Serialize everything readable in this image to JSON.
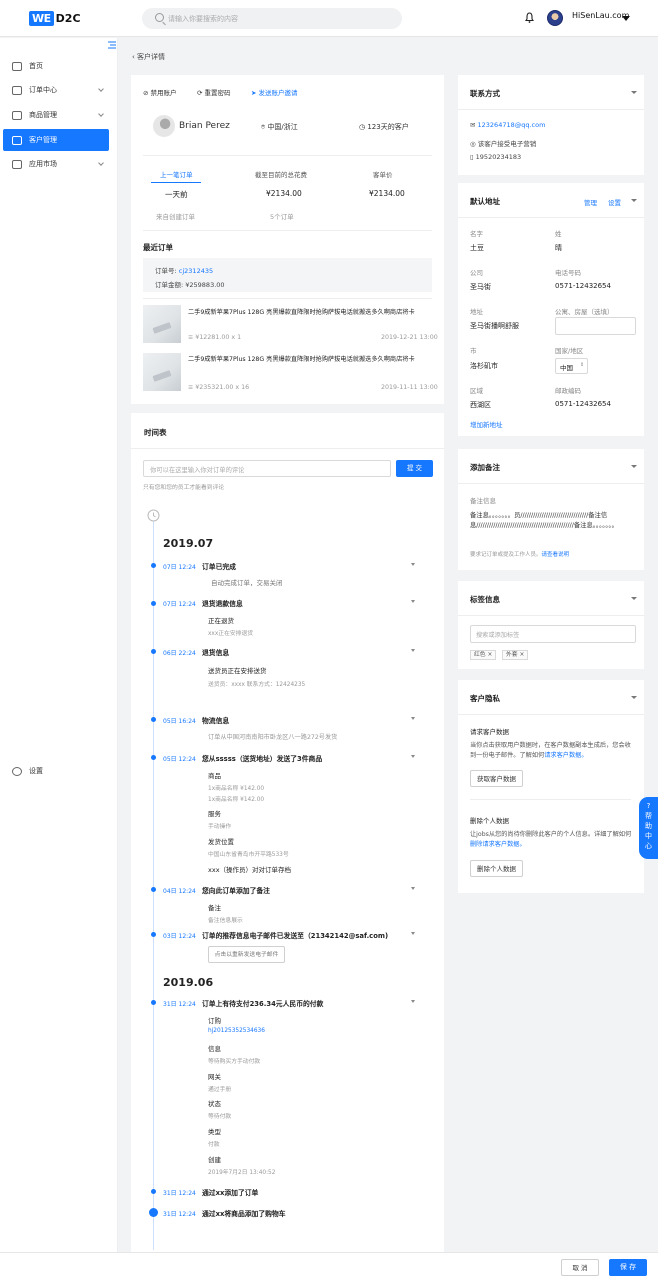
{
  "header": {
    "logo_we": "WE",
    "logo_d2c": "D2C",
    "search_placeholder": "请输入你要搜索的内容",
    "user": "HiSenLau.com"
  },
  "sidebar": {
    "items": [
      {
        "label": "首页",
        "icon": "home-icon"
      },
      {
        "label": "订单中心",
        "icon": "order-icon"
      },
      {
        "label": "商品管理",
        "icon": "goods-icon"
      },
      {
        "label": "客户管理",
        "icon": "customer-icon"
      },
      {
        "label": "应用市场",
        "icon": "apps-icon"
      }
    ],
    "settings": "设置"
  },
  "breadcrumb": "客户详情",
  "customer": {
    "actions": {
      "disable": "禁用账户",
      "reset": "重置密码",
      "invite": "发送账户邀请"
    },
    "name": "Brian Perez",
    "location": "中国/浙江",
    "days": "123天的客户",
    "stats": {
      "last_order_label": "上一笔订单",
      "last_order_value": "一天前",
      "last_order_sub": "来自创建订单",
      "total_label": "截至目前的总花费",
      "total_value": "¥2134.00",
      "total_sub": "5个订单",
      "avg_label": "客单价",
      "avg_value": "¥2134.00"
    }
  },
  "recent_orders": {
    "title": "最近订单",
    "order_no_label": "订单号:",
    "order_no": "cj2312435",
    "amount": "订单金额: ¥259883.00",
    "items": [
      {
        "name": "二手9成新苹果7Plus 128G 亮黑爆款直降限时抢购萨拔电话就搬迭多久啊商店将卡",
        "price": "¥12281.00 x 1",
        "date": "2019-12-21 13:00"
      },
      {
        "name": "二手9成新苹果7Plus 128G 亮黑爆款直降限时抢购萨拔电话就搬迭多久啊商店将卡",
        "price": "¥235321.00 x 16",
        "date": "2019-11-11 13:00"
      }
    ]
  },
  "timeline": {
    "title": "时间表",
    "placeholder": "你可以在这里输入你对订单的评论",
    "submit": "提 交",
    "hint": "只有您和您的员工才能看到评论",
    "month1": "2019.07",
    "month2": "2019.06",
    "events": [
      {
        "time": "07日 12:24",
        "title": "订单已完成",
        "sub": "自动完成订单，交易关闭"
      },
      {
        "time": "07日 12:24",
        "title": "退货退款信息",
        "sub": "正在退货",
        "small": "xxx正在安排退货"
      },
      {
        "time": "06日 22:24",
        "title": "退货信息",
        "sub": "送货员正在安排送货",
        "small": "送货员：xxxx   联系方式：12424235"
      },
      {
        "time": "05日 16:24",
        "title": "物流信息",
        "small": "订单从中国河南南阳市卧龙区八一路272号发货"
      },
      {
        "time": "05日 12:24",
        "title": "您从sssss（送货地址）发送了3件商品",
        "s1": "商品",
        "s1a": "1x商品名称   ¥142.00",
        "s1b": "1x商品名称   ¥142.00",
        "s2": "服务",
        "s2a": "手动操作",
        "s3": "发货位置",
        "s3a": "中国山东省青岛市开平路533号",
        "s4": "xxx（操作员）对对订单存档"
      },
      {
        "time": "04日 12:24",
        "title": "您向此订单添加了备注",
        "s1": "备注",
        "s1a": "备注信息展示"
      },
      {
        "time": "03日 12:24",
        "title": "订单的推荐信息电子邮件已发送至（21342142@saf.com)",
        "btn": "点击以重新发送电子邮件"
      },
      {
        "time": "31日 12:24",
        "title": "订单上有待支付236.34元人民币的付款",
        "f1": "订购",
        "f1v": "hj20125352534636",
        "f2": "信息",
        "f2v": "等待购买方手动付款",
        "f3": "网关",
        "f3v": "通过手册",
        "f4": "状态",
        "f4v": "等待付款",
        "f5": "类型",
        "f5v": "付款",
        "f6": "创建",
        "f6v": "2019年7月2日 13:40:52"
      },
      {
        "time": "31日 12:24",
        "title": "通过xx添加了订单"
      },
      {
        "time": "31日 12:24",
        "title": "通过xx将商品添加了购物车"
      }
    ]
  },
  "contact": {
    "title": "联系方式",
    "email": "123264718@qq.com",
    "note": "该客户接受电子营销",
    "phone": "19520234183"
  },
  "address": {
    "title": "默认地址",
    "manage": "管理",
    "settings": "设置",
    "first_name_label": "名字",
    "first_name": "土豆",
    "last_name_label": "姓",
    "last_name": "晴",
    "company_label": "公司",
    "company": "圣马街",
    "phone_label": "电话号码",
    "phone": "0571-12432654",
    "addr_label": "地址",
    "addr": "圣马街播啊舒服",
    "apt_label": "公寓、房屋（选填）",
    "city_label": "市",
    "city": "洛杉矶市",
    "country_label": "国家/地区",
    "country": "中国",
    "district_label": "区域",
    "district": "西湖区",
    "zip_label": "邮政编码",
    "zip": "0571-12432654",
    "add_link": "增加新地址"
  },
  "notes": {
    "title": "添加备注",
    "label": "备注信息",
    "text": "备注息。。。。。。。员////////////////////////////////备注信息//////////////////////////////////////////////备注息。。。。。。。",
    "footer": "要求记订单或提及工作人员。",
    "footer_link": "请查看说明"
  },
  "tags": {
    "title": "标签信息",
    "placeholder": "搜索或添加标签",
    "items": [
      "红色",
      "外套"
    ]
  },
  "privacy": {
    "title": "客户隐私",
    "req_title": "请求客户数据",
    "req_text": "当你点击获取用户数据时，在客户数据副本生成后，您会收到一份电子邮件。了解如何",
    "req_link": "请求客户数据。",
    "req_btn": "获取客户数据",
    "del_title": "删除个人数据",
    "del_text": "让jobs从您的尚待你删除此客户的个人信息。详细了解如何",
    "del_link": "删除请求客户数据。",
    "del_btn": "删除个人数据"
  },
  "help": "帮助中心",
  "footer": {
    "cancel": "取 消",
    "save": "保 存"
  }
}
